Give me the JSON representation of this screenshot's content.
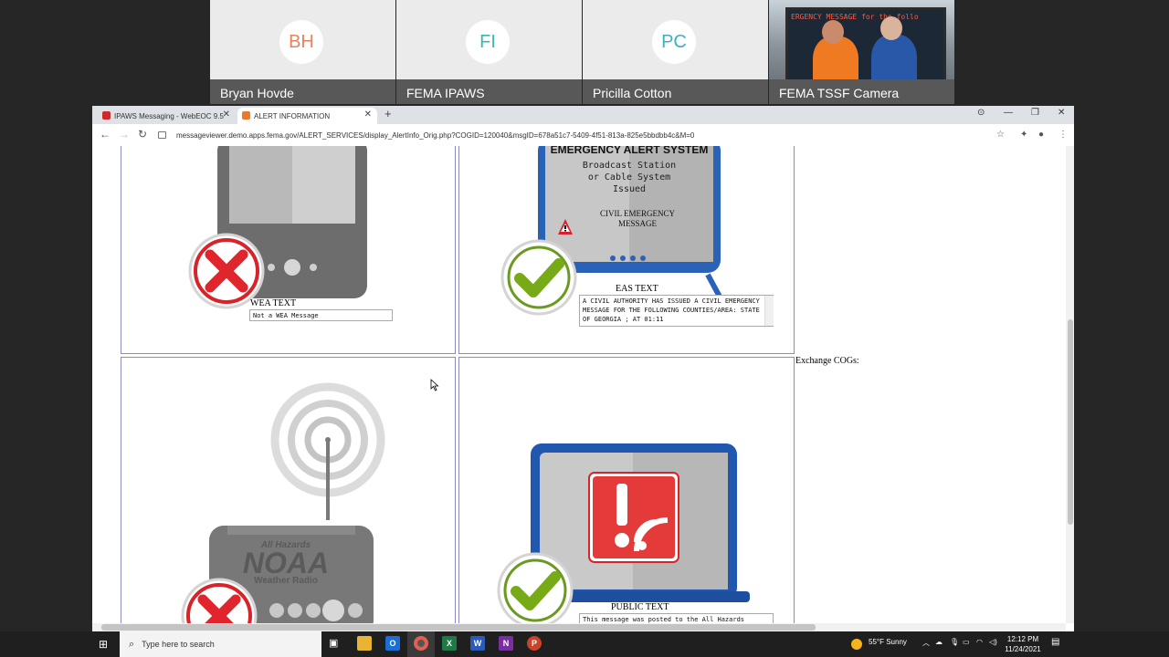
{
  "meeting": {
    "participants": [
      {
        "initials": "BH",
        "name": "Bryan Hovde",
        "color": "#e8825a"
      },
      {
        "initials": "FI",
        "name": "FEMA IPAWS",
        "color": "#3bb9a8"
      },
      {
        "initials": "PC",
        "name": "Pricilla Cotton",
        "color": "#3ab0c6"
      }
    ],
    "camera": {
      "name": "FEMA TSSF Camera",
      "ticker": "ERGENCY MESSAGE for the follo"
    }
  },
  "browser": {
    "tabs": [
      {
        "label": "IPAWS Messaging - WebEOC 9.5",
        "icon_color": "#cc2b2b"
      },
      {
        "label": "ALERT INFORMATION",
        "icon_color": "#e8792e"
      }
    ],
    "url": "messageviewer.demo.apps.fema.gov/ALERT_SERVICES/display_AlertInfo_Orig.php?COGID=120040&msgID=678a51c7-5409-4f51-813a-825e5bbdbb4c&M=0"
  },
  "page": {
    "wea": {
      "caption": "WEA TEXT",
      "text": "Not a WEA Message",
      "status": "cross"
    },
    "eas": {
      "caption": "EAS TEXT",
      "text": "A CIVIL AUTHORITY HAS ISSUED A CIVIL EMERGENCY MESSAGE FOR THE FOLLOWING COUNTIES/AREA: STATE OF GEORGIA ; AT 01:11",
      "status": "check",
      "tv_title": "EMERGENCY ALERT SYSTEM",
      "tv_lines": [
        "Broadcast Station",
        "or Cable System",
        "Issued"
      ],
      "tv_message": [
        "CIVIL EMERGENCY",
        "MESSAGE"
      ]
    },
    "noaa": {
      "status": "cross",
      "logo_top": "All Hazards",
      "logo_main": "NOAA",
      "logo_bottom": "Weather Radio"
    },
    "public": {
      "caption": "PUBLIC TEXT",
      "text": "This message was posted to the All Hazards",
      "status": "check"
    },
    "exchange_label": "Exchange COGs:"
  },
  "taskbar": {
    "search_placeholder": "Type here to search",
    "weather": "55°F  Sunny",
    "time": "12:12 PM",
    "date": "11/24/2021"
  }
}
